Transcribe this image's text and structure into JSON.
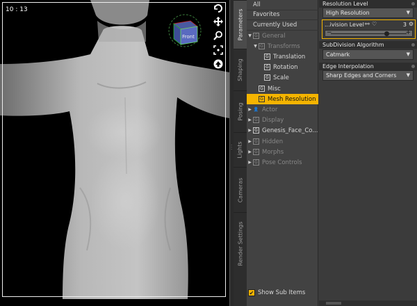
{
  "viewport": {
    "time_label": "10 : 13",
    "cube_label": "Front"
  },
  "vtabs": [
    {
      "label": "Parameters",
      "active": true
    },
    {
      "label": "Shaping",
      "active": false
    },
    {
      "label": "Posing",
      "active": false
    },
    {
      "label": "Lights",
      "active": false
    },
    {
      "label": "Cameras",
      "active": false
    },
    {
      "label": "Render Settings",
      "active": false
    }
  ],
  "tree": {
    "top_items": [
      "All",
      "Favorites",
      "Currently Used"
    ],
    "nodes": [
      {
        "label": "General",
        "arrow": "down",
        "dim": true
      },
      {
        "label": "Transforms",
        "arrow": "down",
        "dim": true
      },
      {
        "label": "Translation",
        "arrow": "",
        "dim": false
      },
      {
        "label": "Rotation",
        "arrow": "",
        "dim": false
      },
      {
        "label": "Scale",
        "arrow": "",
        "dim": false
      },
      {
        "label": "Misc",
        "arrow": "",
        "dim": false
      },
      {
        "label": "Mesh Resolution",
        "arrow": "",
        "dim": false
      },
      {
        "label": "Actor",
        "arrow": "right",
        "dim": true
      },
      {
        "label": "Display",
        "arrow": "right",
        "dim": true
      },
      {
        "label": "Genesis_Face_Co...",
        "arrow": "right",
        "dim": false
      },
      {
        "label": "Hidden",
        "arrow": "right",
        "dim": true
      },
      {
        "label": "Morphs",
        "arrow": "right",
        "dim": true
      },
      {
        "label": "Pose Controls",
        "arrow": "right",
        "dim": true
      }
    ],
    "show_sub_items_label": "Show Sub Items",
    "show_sub_items_checked": true
  },
  "props": {
    "resolution_level": {
      "header": "Resolution Level",
      "value": "High Resolution"
    },
    "subdivision_level": {
      "label": "...ivision Level",
      "value": "3",
      "fraction": 0.75
    },
    "subdivision_algorithm": {
      "header": "SubDivision Algorithm",
      "value": "Catmark"
    },
    "edge_interpolation": {
      "header": "Edge Interpolation",
      "value": "Sharp Edges and Corners"
    }
  },
  "colors": {
    "accent": "#f5b400",
    "panel_bg": "#424242",
    "viewport_bg": "#000000"
  }
}
